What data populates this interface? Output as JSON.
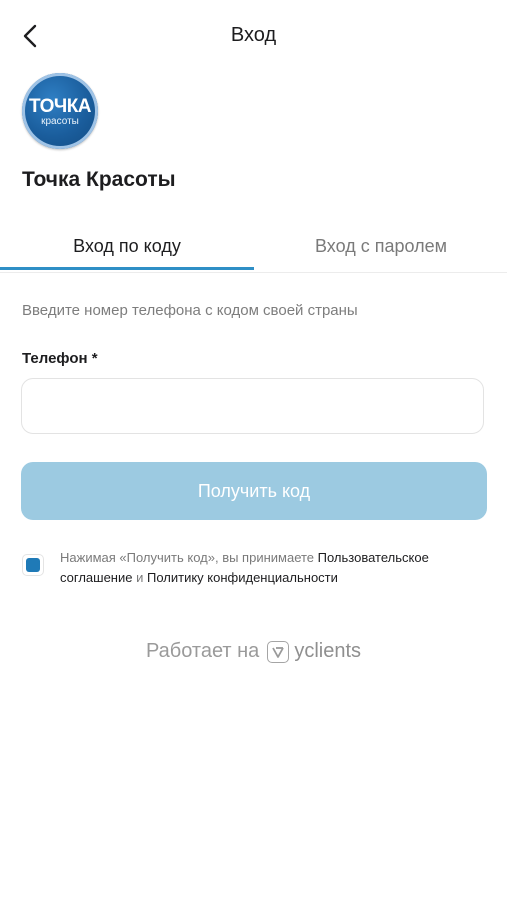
{
  "header": {
    "title": "Вход",
    "back_icon": "chevron-left-icon"
  },
  "salon": {
    "logo_main": "ТОЧКА",
    "logo_sub": "красоты",
    "name": "Точка Красоты"
  },
  "tabs": [
    {
      "label": "Вход по коду",
      "active": true
    },
    {
      "label": "Вход с паролем",
      "active": false
    }
  ],
  "form": {
    "hint": "Введите номер телефона с кодом своей страны",
    "phone_label": "Телефон *",
    "phone_value": "",
    "phone_placeholder": "",
    "submit_label": "Получить код"
  },
  "consent": {
    "checked": true,
    "text_prefix": "Нажимая «Получить код», вы принимаете ",
    "link_agreement": "Пользовательское соглашение",
    "text_and": " и ",
    "link_privacy": "Политику конфиденциальности"
  },
  "footer": {
    "powered_by": "Работает на",
    "brand": "yclients",
    "brand_icon": "yclients-logo-icon"
  },
  "colors": {
    "accent": "#2f8fc6",
    "button_disabled": "#9ccae1",
    "checkbox": "#1f7ab7",
    "logo_blue": "#1a5d9c"
  }
}
